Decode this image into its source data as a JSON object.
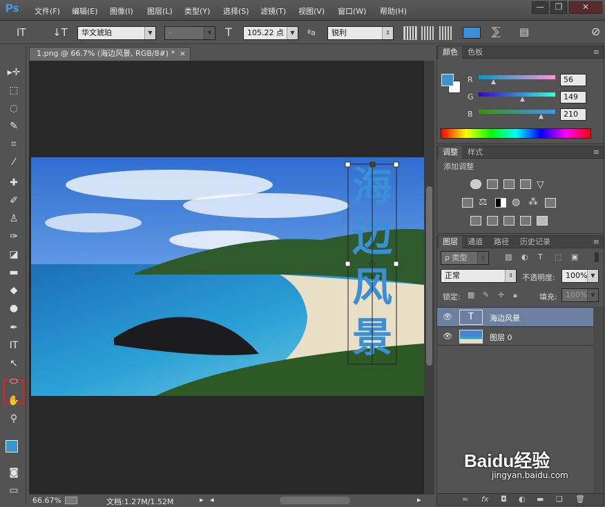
{
  "app": {
    "logo": "Ps"
  },
  "menu": [
    "文件(F)",
    "编辑(E)",
    "图像(I)",
    "图层(L)",
    "类型(Y)",
    "选择(S)",
    "滤镜(T)",
    "视图(V)",
    "窗口(W)",
    "帮助(H)"
  ],
  "window_buttons": {
    "minimize": "—",
    "restore": "❐",
    "close": "✕"
  },
  "options": {
    "font_family": "华文琥珀",
    "font_style": "-",
    "font_size": "105.22 点",
    "antialias_label": "ªa",
    "antialias": "锐利",
    "text_color": "#3a8fd6"
  },
  "document": {
    "tab_title": "1.png @ 66.7% (海边风景, RGB/8#) *",
    "text_layer_content": [
      "海",
      "边",
      "风",
      "景"
    ],
    "text_color": "#3a8fd6"
  },
  "status": {
    "zoom": "66.67%",
    "doc_info": "文档:1.27M/1.52M"
  },
  "color_panel": {
    "tabs": [
      "颜色",
      "色板"
    ],
    "channels": [
      {
        "label": "R",
        "value": "56"
      },
      {
        "label": "G",
        "value": "149"
      },
      {
        "label": "B",
        "value": "210"
      }
    ],
    "foreground": "#3895d2",
    "background": "#ffffff"
  },
  "adjust_panel": {
    "tabs": [
      "调整",
      "样式"
    ],
    "title": "添加调整"
  },
  "layers_panel": {
    "tabs": [
      "图层",
      "通道",
      "路径",
      "历史记录"
    ],
    "filter_kind": "ρ 类型",
    "blend_mode": "正常",
    "opacity_label": "不透明度:",
    "opacity": "100%",
    "lock_label": "锁定:",
    "fill_label": "填充:",
    "fill": "100%",
    "layers": [
      {
        "name": "海边风景",
        "kind": "text",
        "selected": true
      },
      {
        "name": "图层 0",
        "kind": "image",
        "selected": false
      }
    ],
    "footer_icons": [
      "link-icon",
      "fx-icon",
      "mask-icon",
      "adjustment-icon",
      "folder-icon",
      "new-layer-icon",
      "trash-icon"
    ]
  },
  "watermark": {
    "brand": "Baidu经验",
    "url": "jingyan.baidu.com"
  }
}
